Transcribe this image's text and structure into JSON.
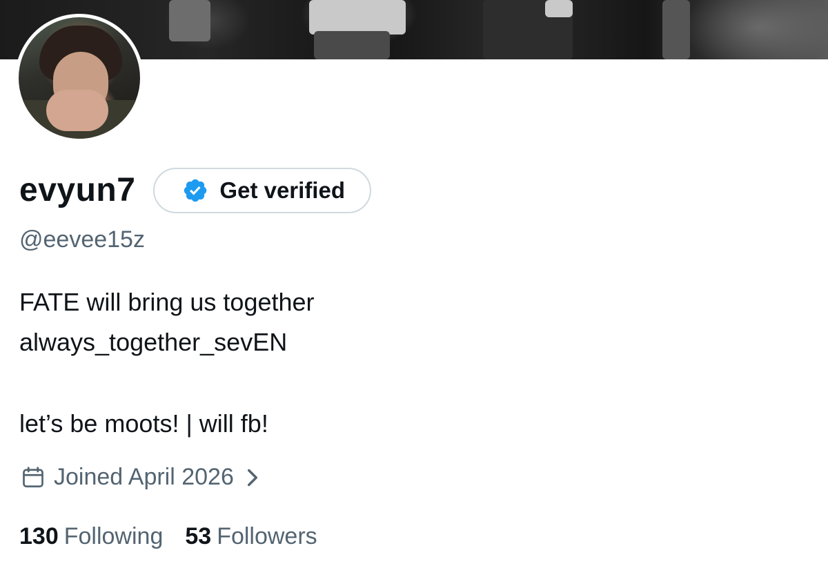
{
  "profile": {
    "display_name": "evyun7",
    "handle": "@eevee15z",
    "verify_button_label": "Get verified",
    "bio_lines": [
      "FATE will bring us together",
      "always_together_sevEN",
      "",
      "let’s be moots! | will fb!"
    ],
    "joined": "Joined April 2026",
    "stats": {
      "following_count": "130",
      "following_label": "Following",
      "followers_count": "53",
      "followers_label": "Followers"
    }
  },
  "icons": {
    "verify_badge": "verified-badge-icon",
    "calendar": "calendar-icon",
    "chevron": "chevron-right-icon"
  },
  "colors": {
    "verified_blue": "#1d9bf0",
    "secondary_text": "#536471",
    "primary_text": "#0f1419",
    "button_border": "#cfd9de"
  }
}
